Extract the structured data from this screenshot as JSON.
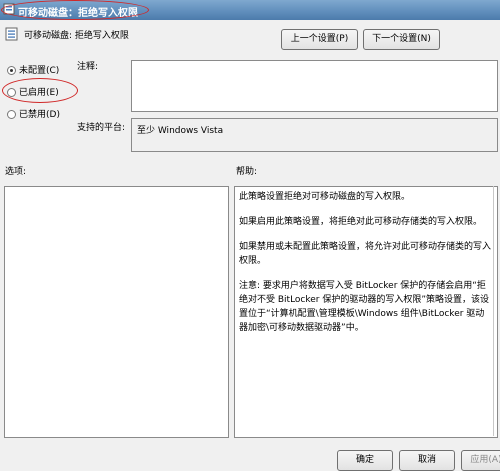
{
  "window": {
    "title": "可移动磁盘：拒绝写入权限"
  },
  "header": {
    "policy_name": "可移动磁盘: 拒绝写入权限"
  },
  "nav": {
    "prev_label": "上一个设置(P)",
    "next_label": "下一个设置(N)"
  },
  "state_options": [
    {
      "label": "未配置(C)",
      "selected": true
    },
    {
      "label": "已启用(E)",
      "selected": false
    },
    {
      "label": "已禁用(D)",
      "selected": false
    }
  ],
  "comment": {
    "label": "注释:",
    "value": ""
  },
  "platform": {
    "label": "支持的平台:",
    "value": "至少 Windows Vista"
  },
  "options": {
    "label": "选项:"
  },
  "help": {
    "label": "帮助:",
    "paragraphs": [
      "此策略设置拒绝对可移动磁盘的写入权限。",
      "如果启用此策略设置，将拒绝对此可移动存储类的写入权限。",
      "如果禁用或未配置此策略设置，将允许对此可移动存储类的写入权限。",
      "注意: 要求用户将数据写入受 BitLocker 保护的存储会启用“拒绝对不受 BitLocker 保护的驱动器的写入权限”策略设置，该设置位于“计算机配置\\管理模板\\Windows 组件\\BitLocker 驱动器加密\\可移动数据驱动器”中。"
    ]
  },
  "footer": {
    "ok_label": "确定",
    "cancel_label": "取消",
    "apply_label": "应用(A)"
  },
  "colors": {
    "annotation": "#d02828",
    "titlebar": "#5f8dbb"
  }
}
